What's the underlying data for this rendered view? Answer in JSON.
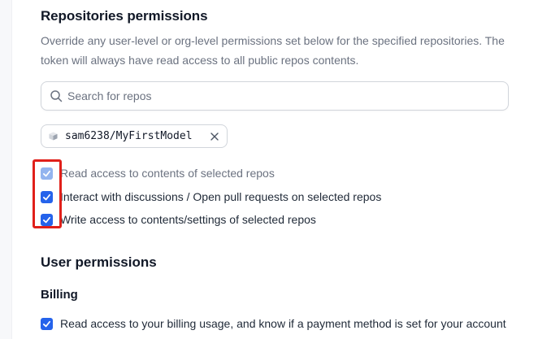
{
  "repositories_permissions": {
    "title": "Repositories permissions",
    "description": "Override any user-level or org-level permissions set below for the specified repositories. The token will always have read access to all public repos contents.",
    "search": {
      "placeholder": "Search for repos",
      "value": ""
    },
    "selected_repo": {
      "name": "sam6238/MyFirstModel"
    },
    "options": [
      {
        "label": "Read access to contents of selected repos",
        "checked": true,
        "disabled": true
      },
      {
        "label": "Interact with discussions / Open pull requests on selected repos",
        "checked": true,
        "disabled": false
      },
      {
        "label": "Write access to contents/settings of selected repos",
        "checked": true,
        "disabled": false
      }
    ]
  },
  "user_permissions": {
    "title": "User permissions",
    "billing": {
      "title": "Billing",
      "options": [
        {
          "label": "Read access to your billing usage, and know if a payment method is set for your account",
          "checked": true,
          "disabled": false
        }
      ]
    }
  },
  "colors": {
    "checkbox_active": "#2563eb",
    "checkbox_disabled": "#93b4ef",
    "highlight": "#e0201a"
  }
}
